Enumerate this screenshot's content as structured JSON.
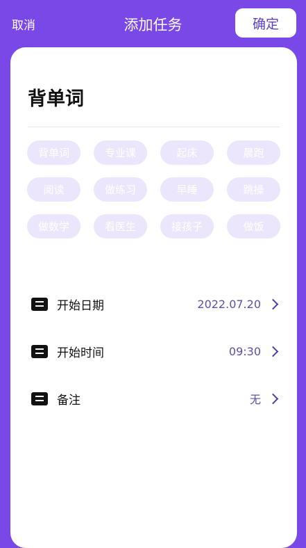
{
  "header": {
    "cancel_label": "取消",
    "title": "添加任务",
    "confirm_label": "确定"
  },
  "task": {
    "name": "背单词"
  },
  "chips": [
    "背单词",
    "专业课",
    "起床",
    "晨跑",
    "阅读",
    "做练习",
    "早睡",
    "跳操",
    "做数学",
    "看医生",
    "接孩子",
    "做饭"
  ],
  "settings": [
    {
      "label": "开始日期",
      "value": "2022.07.20",
      "icon": "calendar-icon"
    },
    {
      "label": "开始时间",
      "value": "09:30",
      "icon": "clock-icon"
    },
    {
      "label": "备注",
      "value": "无",
      "icon": "note-icon"
    }
  ],
  "colors": {
    "background": "#7b48e8",
    "chip_background": "#ebe6fb",
    "value_text": "#5b4fb0"
  }
}
